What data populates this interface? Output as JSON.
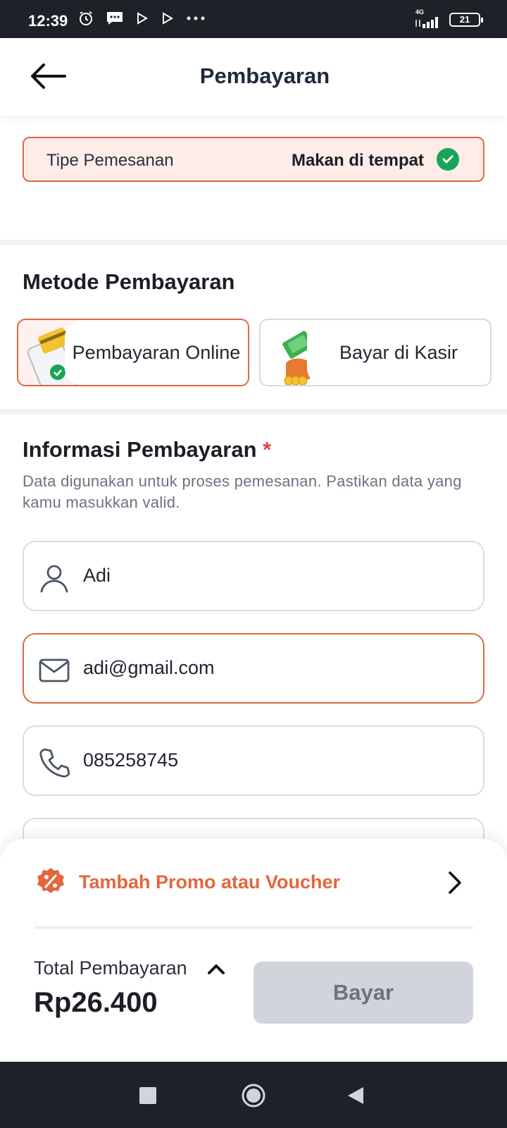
{
  "status_bar": {
    "time": "12:39",
    "network": "4G",
    "battery": "21"
  },
  "header": {
    "title": "Pembayaran"
  },
  "order_type": {
    "label": "Tipe Pemesanan",
    "value": "Makan di tempat"
  },
  "payment_method": {
    "title": "Metode Pembayaran",
    "options": [
      {
        "label": "Pembayaran Online",
        "selected": true
      },
      {
        "label": "Bayar di Kasir",
        "selected": false
      }
    ]
  },
  "payment_info": {
    "title": "Informasi Pembayaran",
    "required_mark": "*",
    "description": "Data digunakan untuk proses pemesanan. Pastikan data yang kamu masukkan valid.",
    "fields": [
      {
        "icon": "user-icon",
        "value": "Adi"
      },
      {
        "icon": "mail-icon",
        "value": "adi@gmail.com"
      },
      {
        "icon": "phone-icon",
        "value": "085258745"
      }
    ]
  },
  "footer": {
    "promo_label": "Tambah Promo atau Voucher",
    "total_label": "Total Pembayaran",
    "total_amount": "Rp26.400",
    "pay_button": "Bayar"
  },
  "colors": {
    "accent": "#e2673f",
    "success": "#18a558",
    "disabled_button": "#d1d5db"
  }
}
